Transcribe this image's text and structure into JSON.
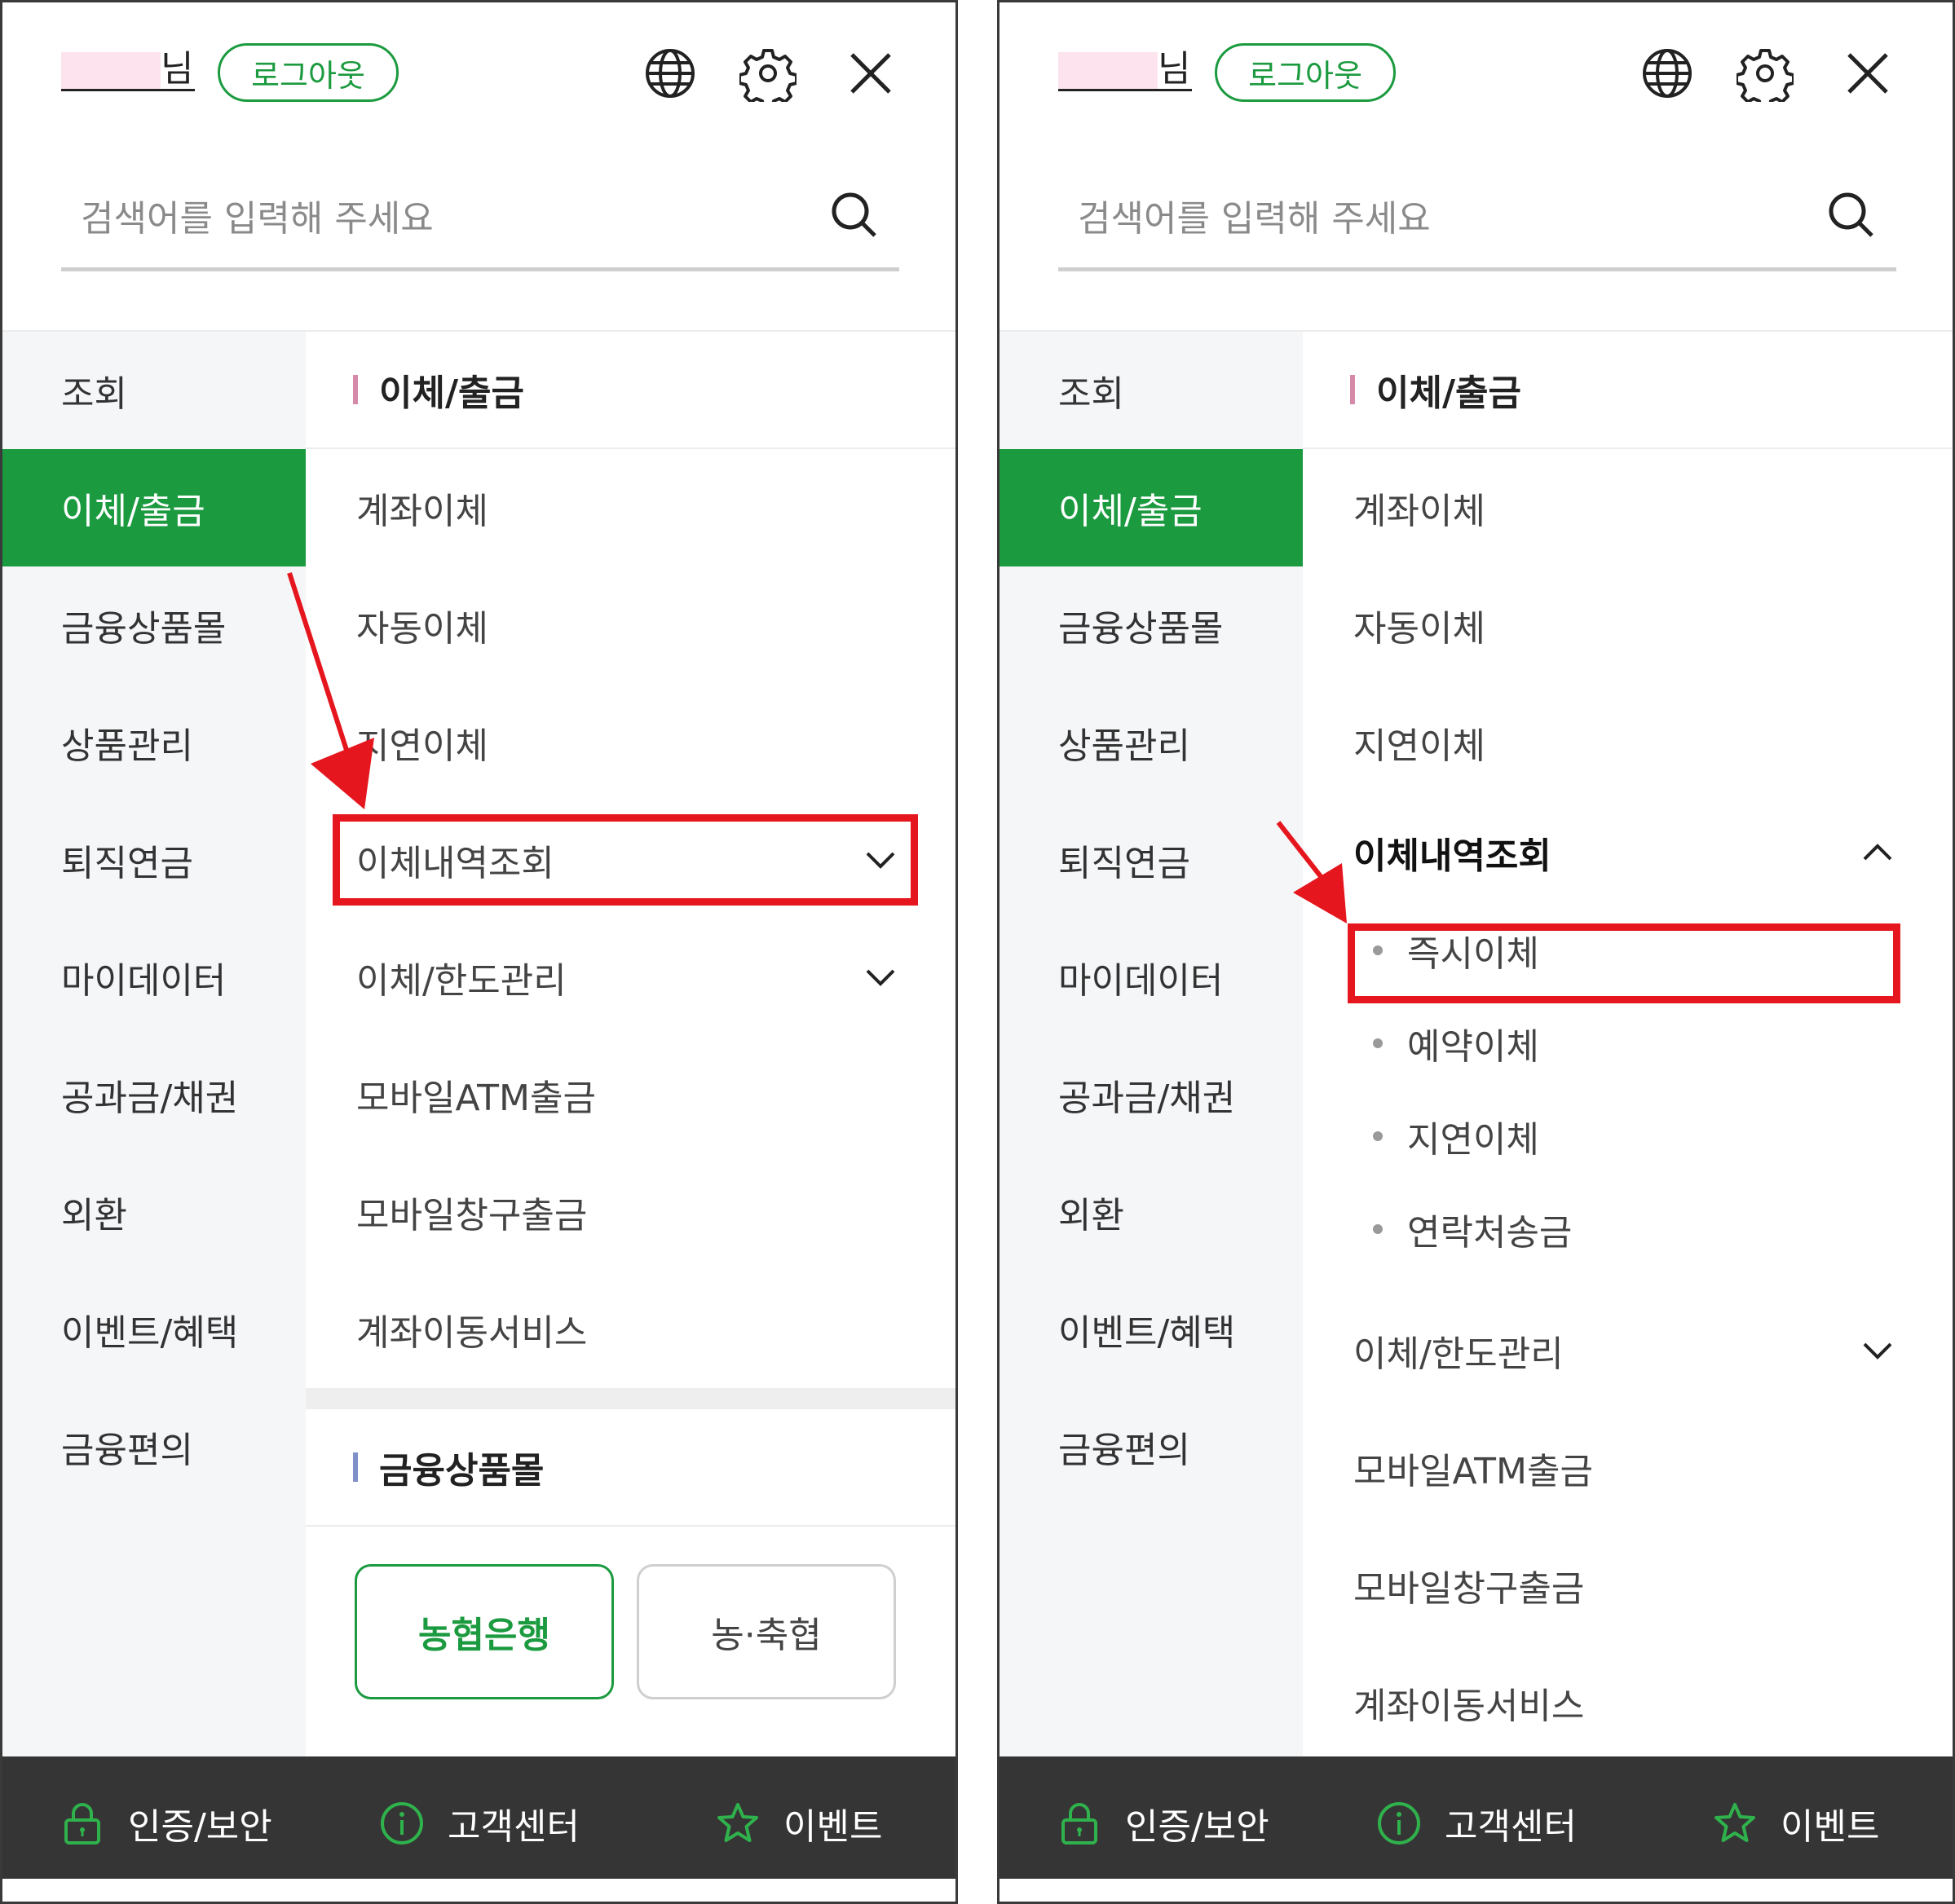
{
  "colors": {
    "accent": "#1b9a3f",
    "footer": "#353535",
    "annotation": "#e5161e"
  },
  "header": {
    "user_suffix": "님",
    "logout_label": "로그아웃",
    "icons": [
      "globe-icon",
      "gear-icon",
      "close-icon"
    ]
  },
  "search": {
    "placeholder": "검색어를 입력해 주세요"
  },
  "sidebar": {
    "items": [
      "조회",
      "이체/출금",
      "금융상품몰",
      "상품관리",
      "퇴직연금",
      "마이데이터",
      "공과금/채권",
      "외환",
      "이벤트/혜택",
      "금융편의"
    ],
    "active": "이체/출금"
  },
  "content": {
    "section1_title": "이체/출금",
    "items": [
      "계좌이체",
      "자동이체",
      "지연이체",
      "이체내역조회",
      "이체/한도관리",
      "모바일ATM출금",
      "모바일창구출금",
      "계좌이동서비스"
    ],
    "subitems": [
      "즉시이체",
      "예약이체",
      "지연이체",
      "연락처송금"
    ],
    "section2_title": "금융상품몰",
    "bank_buttons": [
      "농협은행",
      "농·축협"
    ]
  },
  "footer": {
    "items": [
      "인증/보안",
      "고객센터",
      "이벤트"
    ]
  }
}
